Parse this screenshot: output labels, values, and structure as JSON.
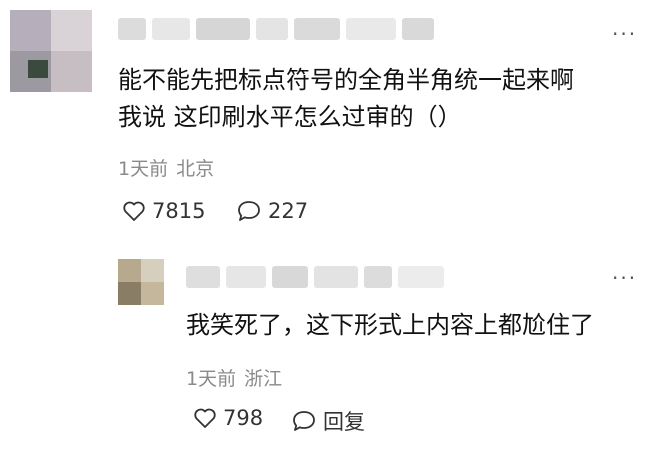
{
  "comment": {
    "text_line1": "能不能先把标点符号的全角半角统一起来啊",
    "text_line2": "我说 这印刷水平怎么过审的（）",
    "time": "1天前",
    "location": "北京",
    "likes": "7815",
    "replies": "227",
    "more_label": "···"
  },
  "reply": {
    "text": "我笑死了，这下形式上内容上都尬住了",
    "time": "1天前",
    "location": "浙江",
    "likes": "798",
    "reply_label": "回复",
    "more_label": "···"
  },
  "icons": {
    "like": "heart-outline-icon",
    "comment": "speech-bubble-icon",
    "more": "more-dots-icon"
  },
  "colors": {
    "text": "#111111",
    "meta": "#8a8a8a",
    "icon": "#333333"
  }
}
